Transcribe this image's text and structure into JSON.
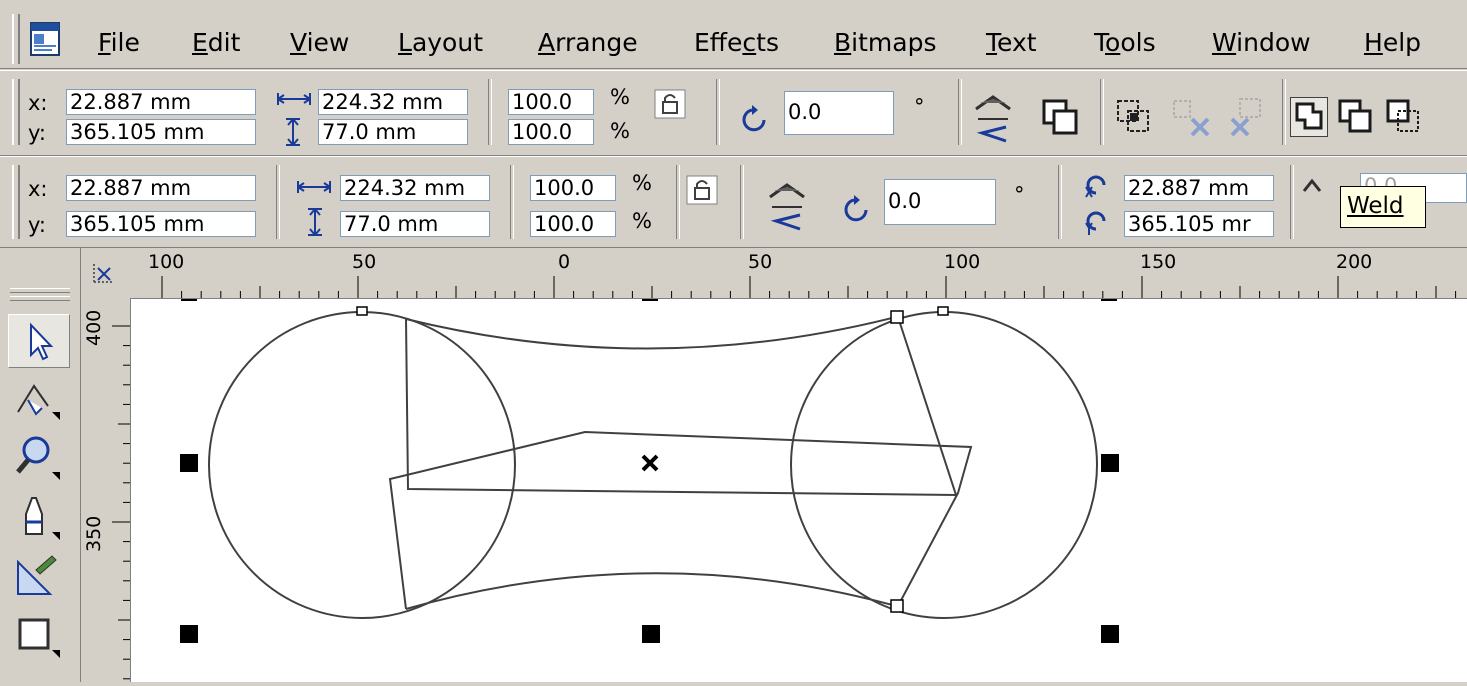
{
  "menu": {
    "items": [
      {
        "id": "file",
        "pre": "",
        "u": "F",
        "post": "ile"
      },
      {
        "id": "edit",
        "pre": "",
        "u": "E",
        "post": "dit"
      },
      {
        "id": "view",
        "pre": "",
        "u": "V",
        "post": "iew"
      },
      {
        "id": "layout",
        "pre": "",
        "u": "L",
        "post": "ayout"
      },
      {
        "id": "arrange",
        "pre": "",
        "u": "A",
        "post": "rrange"
      },
      {
        "id": "effects",
        "pre": "Effe",
        "u": "c",
        "post": "ts"
      },
      {
        "id": "bitmaps",
        "pre": "",
        "u": "B",
        "post": "itmaps"
      },
      {
        "id": "text",
        "pre": "",
        "u": "T",
        "post": "ext"
      },
      {
        "id": "tools",
        "pre": "T",
        "u": "o",
        "post": "ols"
      },
      {
        "id": "window",
        "pre": "",
        "u": "W",
        "post": "indow"
      },
      {
        "id": "help",
        "pre": "",
        "u": "H",
        "post": "elp"
      }
    ]
  },
  "propbar1": {
    "x_label": "x:",
    "y_label": "y:",
    "x_value": "22.887 mm",
    "y_value": "365.105 mm",
    "width_value": "224.32 mm",
    "height_value": "77.0 mm",
    "scale_x": "100.0",
    "scale_y": "100.0",
    "percent": "%",
    "rotation": "0.0",
    "degree": "°"
  },
  "propbar2": {
    "x_label": "x:",
    "y_label": "y:",
    "x_value": "22.887 mm",
    "y_value": "365.105 mm",
    "width_value": "224.32 mm",
    "height_value": "77.0 mm",
    "scale_x": "100.0",
    "scale_y": "100.0",
    "percent": "%",
    "rotation": "0.0",
    "degree": "°",
    "center_x": "22.887 mm",
    "center_y": "365.105 mr",
    "partial_field": "0.0"
  },
  "tooltip": "Weld",
  "ruler_top": {
    "labels": [
      "100",
      "50",
      "0",
      "50",
      "100",
      "150",
      "200"
    ]
  },
  "ruler_left": {
    "labels": [
      "400",
      "350"
    ]
  },
  "icons": {
    "doc": "document-icon",
    "lock": "lock-ratio-icon",
    "rotate": "rotate-icon",
    "mirror": "mirror-icon",
    "weld": "weld-icon",
    "trim": "trim-icon",
    "intersect": "intersect-icon"
  },
  "colors": {
    "chrome": "#d4d0c8",
    "field_border": "#7f9db9",
    "tooltip_bg": "#ffffe1",
    "canvas": "#ffffff"
  }
}
